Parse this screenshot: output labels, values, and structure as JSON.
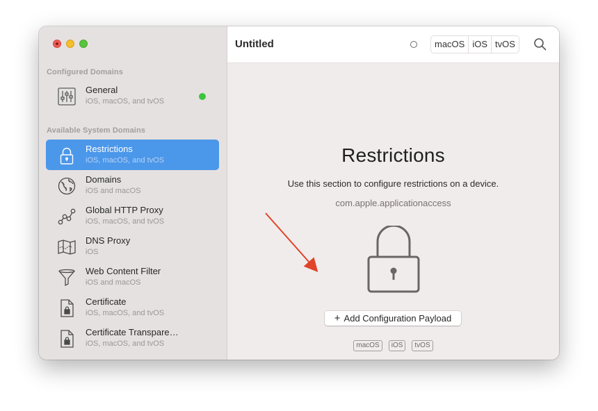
{
  "window": {
    "title": "Untitled",
    "platform_tabs": [
      "macOS",
      "iOS",
      "tvOS"
    ]
  },
  "sidebar": {
    "configured_header": "Configured Domains",
    "configured_items": [
      {
        "title": "General",
        "subtitle": "iOS, macOS, and tvOS",
        "icon": "sliders-icon",
        "status": "configured",
        "status_color": "#3dc43f"
      }
    ],
    "available_header": "Available System Domains",
    "available_items": [
      {
        "title": "Restrictions",
        "subtitle": "iOS, macOS, and tvOS",
        "icon": "lock-icon",
        "selected": true
      },
      {
        "title": "Domains",
        "subtitle": "iOS and macOS",
        "icon": "globe-icon"
      },
      {
        "title": "Global HTTP Proxy",
        "subtitle": "iOS, macOS, and tvOS",
        "icon": "proxy-nodes-icon"
      },
      {
        "title": "DNS Proxy",
        "subtitle": "iOS",
        "icon": "map-icon"
      },
      {
        "title": "Web Content Filter",
        "subtitle": "iOS and macOS",
        "icon": "funnel-icon"
      },
      {
        "title": "Certificate",
        "subtitle": "iOS, macOS, and tvOS",
        "icon": "certificate-icon"
      },
      {
        "title": "Certificate Transpare…",
        "subtitle": "iOS, macOS, and tvOS",
        "icon": "certificate-icon"
      }
    ]
  },
  "main": {
    "heading": "Restrictions",
    "description": "Use this section to configure restrictions on a device.",
    "bundle_id": "com.apple.applicationaccess",
    "add_button_label": "Add Configuration Payload",
    "platform_badges": [
      "macOS",
      "iOS",
      "tvOS"
    ]
  },
  "colors": {
    "accent": "#4b97ea",
    "sidebar_bg": "#e6e1e1",
    "content_bg": "#f1ecec",
    "status_green": "#3dc43f",
    "annotation_arrow": "#e0442a"
  }
}
